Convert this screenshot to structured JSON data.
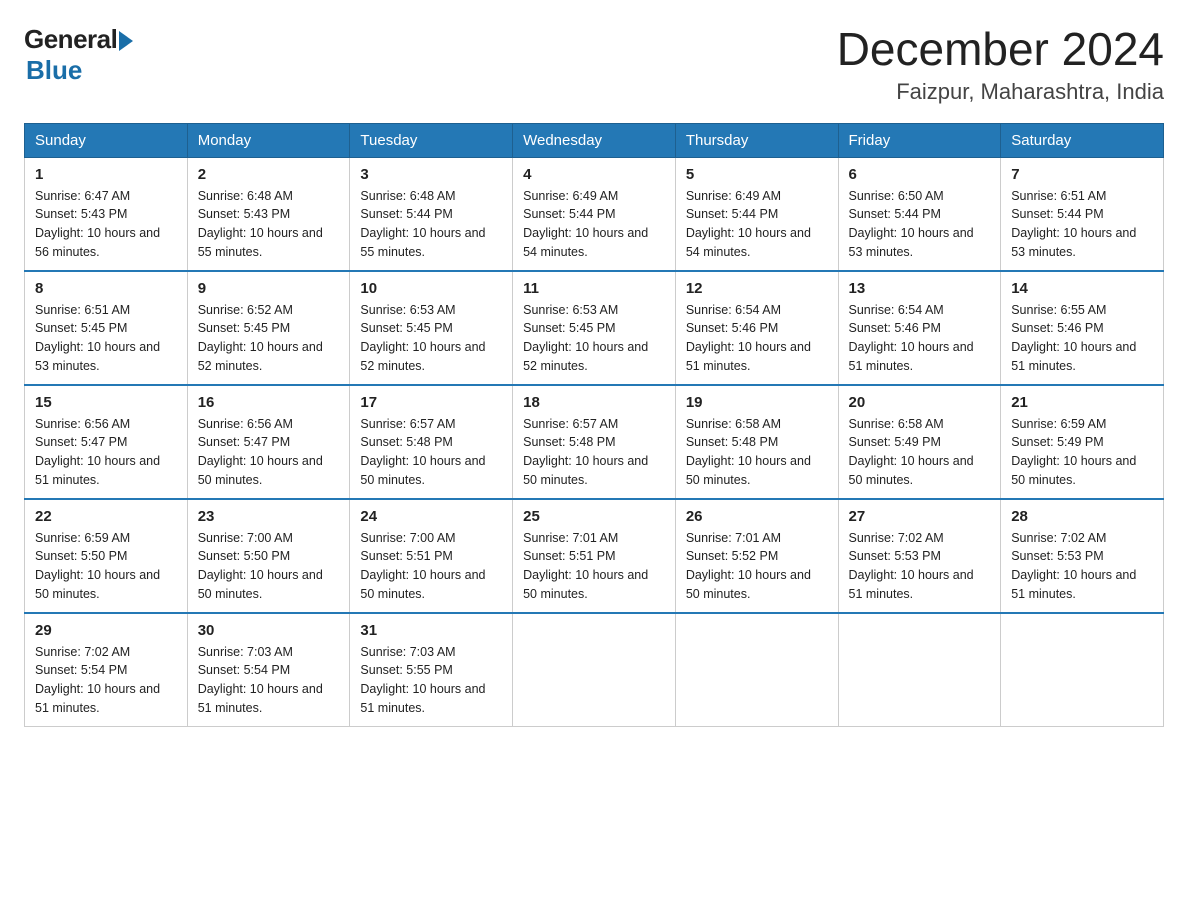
{
  "header": {
    "logo_general": "General",
    "logo_blue": "Blue",
    "month_title": "December 2024",
    "location": "Faizpur, Maharashtra, India"
  },
  "days_of_week": [
    "Sunday",
    "Monday",
    "Tuesday",
    "Wednesday",
    "Thursday",
    "Friday",
    "Saturday"
  ],
  "weeks": [
    [
      {
        "day": "1",
        "sunrise": "6:47 AM",
        "sunset": "5:43 PM",
        "daylight": "10 hours and 56 minutes."
      },
      {
        "day": "2",
        "sunrise": "6:48 AM",
        "sunset": "5:43 PM",
        "daylight": "10 hours and 55 minutes."
      },
      {
        "day": "3",
        "sunrise": "6:48 AM",
        "sunset": "5:44 PM",
        "daylight": "10 hours and 55 minutes."
      },
      {
        "day": "4",
        "sunrise": "6:49 AM",
        "sunset": "5:44 PM",
        "daylight": "10 hours and 54 minutes."
      },
      {
        "day": "5",
        "sunrise": "6:49 AM",
        "sunset": "5:44 PM",
        "daylight": "10 hours and 54 minutes."
      },
      {
        "day": "6",
        "sunrise": "6:50 AM",
        "sunset": "5:44 PM",
        "daylight": "10 hours and 53 minutes."
      },
      {
        "day": "7",
        "sunrise": "6:51 AM",
        "sunset": "5:44 PM",
        "daylight": "10 hours and 53 minutes."
      }
    ],
    [
      {
        "day": "8",
        "sunrise": "6:51 AM",
        "sunset": "5:45 PM",
        "daylight": "10 hours and 53 minutes."
      },
      {
        "day": "9",
        "sunrise": "6:52 AM",
        "sunset": "5:45 PM",
        "daylight": "10 hours and 52 minutes."
      },
      {
        "day": "10",
        "sunrise": "6:53 AM",
        "sunset": "5:45 PM",
        "daylight": "10 hours and 52 minutes."
      },
      {
        "day": "11",
        "sunrise": "6:53 AM",
        "sunset": "5:45 PM",
        "daylight": "10 hours and 52 minutes."
      },
      {
        "day": "12",
        "sunrise": "6:54 AM",
        "sunset": "5:46 PM",
        "daylight": "10 hours and 51 minutes."
      },
      {
        "day": "13",
        "sunrise": "6:54 AM",
        "sunset": "5:46 PM",
        "daylight": "10 hours and 51 minutes."
      },
      {
        "day": "14",
        "sunrise": "6:55 AM",
        "sunset": "5:46 PM",
        "daylight": "10 hours and 51 minutes."
      }
    ],
    [
      {
        "day": "15",
        "sunrise": "6:56 AM",
        "sunset": "5:47 PM",
        "daylight": "10 hours and 51 minutes."
      },
      {
        "day": "16",
        "sunrise": "6:56 AM",
        "sunset": "5:47 PM",
        "daylight": "10 hours and 50 minutes."
      },
      {
        "day": "17",
        "sunrise": "6:57 AM",
        "sunset": "5:48 PM",
        "daylight": "10 hours and 50 minutes."
      },
      {
        "day": "18",
        "sunrise": "6:57 AM",
        "sunset": "5:48 PM",
        "daylight": "10 hours and 50 minutes."
      },
      {
        "day": "19",
        "sunrise": "6:58 AM",
        "sunset": "5:48 PM",
        "daylight": "10 hours and 50 minutes."
      },
      {
        "day": "20",
        "sunrise": "6:58 AM",
        "sunset": "5:49 PM",
        "daylight": "10 hours and 50 minutes."
      },
      {
        "day": "21",
        "sunrise": "6:59 AM",
        "sunset": "5:49 PM",
        "daylight": "10 hours and 50 minutes."
      }
    ],
    [
      {
        "day": "22",
        "sunrise": "6:59 AM",
        "sunset": "5:50 PM",
        "daylight": "10 hours and 50 minutes."
      },
      {
        "day": "23",
        "sunrise": "7:00 AM",
        "sunset": "5:50 PM",
        "daylight": "10 hours and 50 minutes."
      },
      {
        "day": "24",
        "sunrise": "7:00 AM",
        "sunset": "5:51 PM",
        "daylight": "10 hours and 50 minutes."
      },
      {
        "day": "25",
        "sunrise": "7:01 AM",
        "sunset": "5:51 PM",
        "daylight": "10 hours and 50 minutes."
      },
      {
        "day": "26",
        "sunrise": "7:01 AM",
        "sunset": "5:52 PM",
        "daylight": "10 hours and 50 minutes."
      },
      {
        "day": "27",
        "sunrise": "7:02 AM",
        "sunset": "5:53 PM",
        "daylight": "10 hours and 51 minutes."
      },
      {
        "day": "28",
        "sunrise": "7:02 AM",
        "sunset": "5:53 PM",
        "daylight": "10 hours and 51 minutes."
      }
    ],
    [
      {
        "day": "29",
        "sunrise": "7:02 AM",
        "sunset": "5:54 PM",
        "daylight": "10 hours and 51 minutes."
      },
      {
        "day": "30",
        "sunrise": "7:03 AM",
        "sunset": "5:54 PM",
        "daylight": "10 hours and 51 minutes."
      },
      {
        "day": "31",
        "sunrise": "7:03 AM",
        "sunset": "5:55 PM",
        "daylight": "10 hours and 51 minutes."
      },
      null,
      null,
      null,
      null
    ]
  ],
  "labels": {
    "sunrise": "Sunrise:",
    "sunset": "Sunset:",
    "daylight": "Daylight:"
  }
}
